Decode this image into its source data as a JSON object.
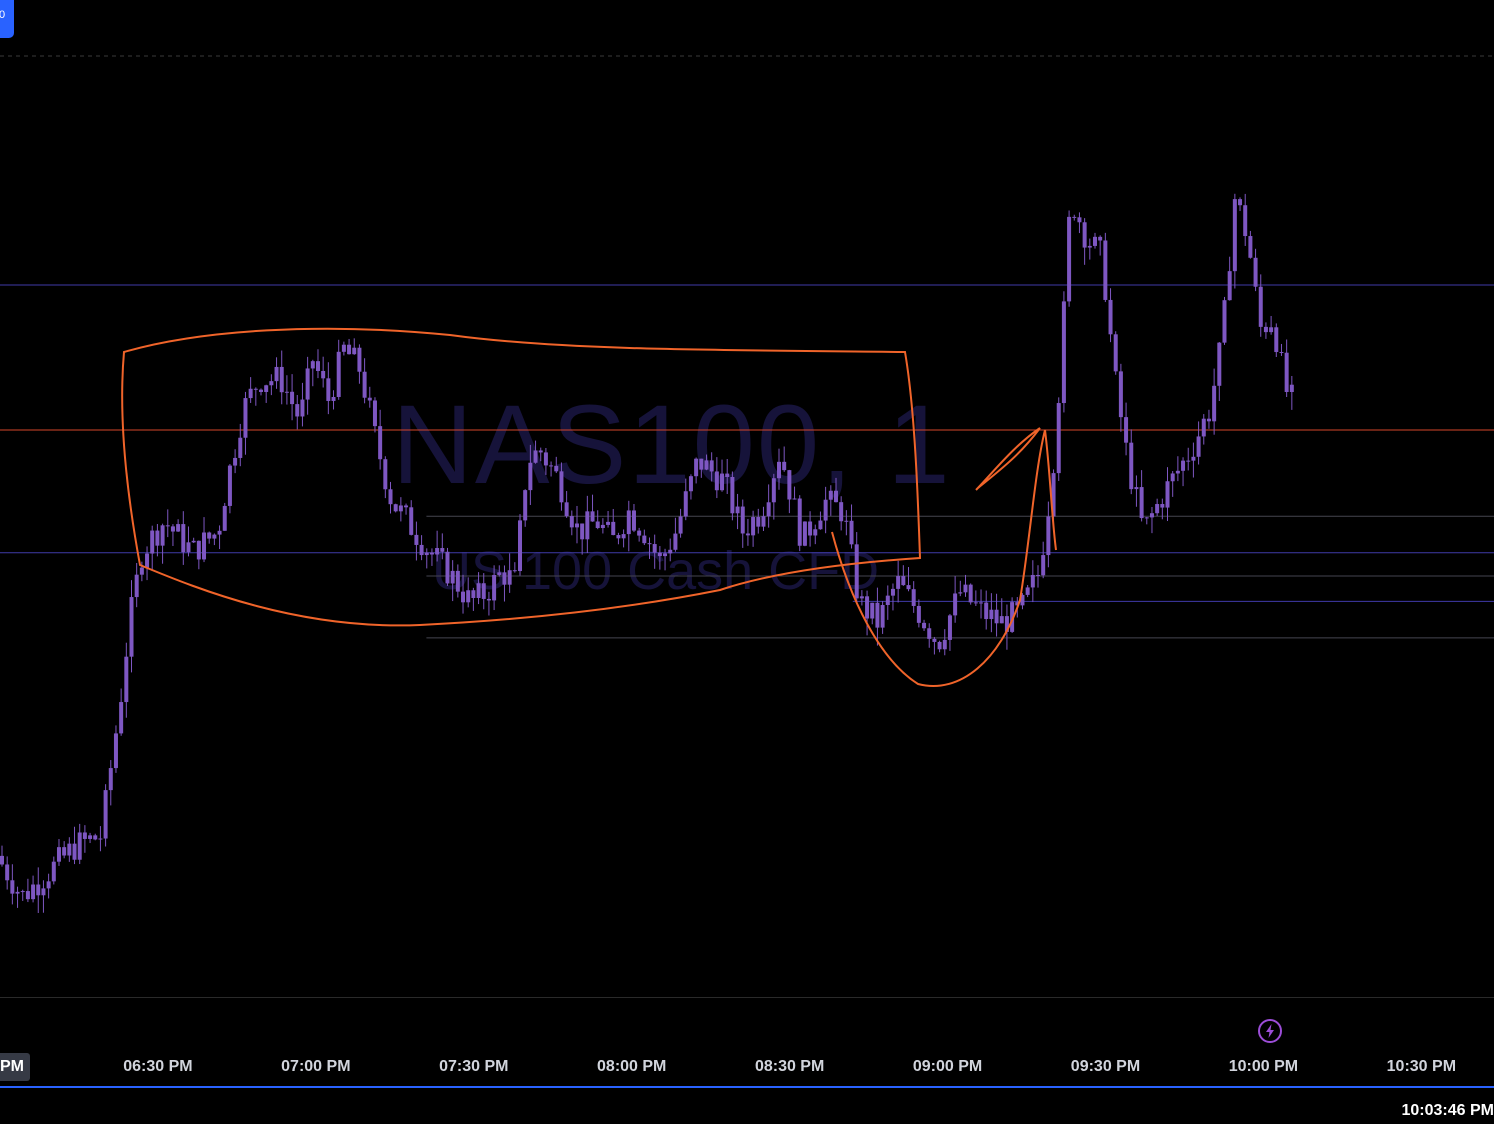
{
  "watermark": {
    "symbol": "NAS100, 1",
    "description": "US 100 Cash CFD"
  },
  "corner_button_label": "0",
  "time_axis": {
    "cut_label": "PM",
    "cut_label_2": "PM",
    "ticks": [
      {
        "label": "06:30 PM",
        "time": 18.5
      },
      {
        "label": "07:00 PM",
        "time": 19.0
      },
      {
        "label": "07:30 PM",
        "time": 19.5
      },
      {
        "label": "08:00 PM",
        "time": 20.0
      },
      {
        "label": "08:30 PM",
        "time": 20.5
      },
      {
        "label": "09:00 PM",
        "time": 21.0
      },
      {
        "label": "09:30 PM",
        "time": 21.5
      },
      {
        "label": "10:00 PM",
        "time": 22.0
      },
      {
        "label": "10:30 PM",
        "time": 22.5
      }
    ]
  },
  "clock": "10:03:46 PM",
  "colors": {
    "candle": "#7e57c2",
    "level_line": "#3f3aa8",
    "key_level": "#d4462a",
    "gray_level": "#45454f",
    "drawing": "#f0642a",
    "watermark": "#16133a"
  },
  "chart_data": {
    "type": "candlestick",
    "title": "",
    "xlabel": "",
    "ylabel": "",
    "x_unit": "hour",
    "x_range": [
      18.0,
      22.73
    ],
    "y_range": [
      0,
      1000
    ],
    "grid": false,
    "levels": [
      {
        "value": 713,
        "style": "line",
        "color": "#3f3aa8"
      },
      {
        "value": 570,
        "style": "line",
        "color": "#d4462a"
      },
      {
        "value": 449,
        "style": "line",
        "color": "#3f3aa8"
      },
      {
        "value": 401,
        "style": "line",
        "color": "#3f3aa8",
        "from": 20.7
      },
      {
        "value": 485,
        "style": "line",
        "color": "#45454f",
        "from": 19.35
      },
      {
        "value": 426,
        "style": "line",
        "color": "#45454f",
        "from": 19.35
      },
      {
        "value": 365,
        "style": "line",
        "color": "#45454f",
        "from": 19.35
      }
    ],
    "anchors": [
      [
        18.0,
        150
      ],
      [
        18.08,
        110
      ],
      [
        18.15,
        130
      ],
      [
        18.25,
        160
      ],
      [
        18.33,
        170
      ],
      [
        18.39,
        300
      ],
      [
        18.42,
        380
      ],
      [
        18.46,
        450
      ],
      [
        18.53,
        480
      ],
      [
        18.62,
        450
      ],
      [
        18.7,
        470
      ],
      [
        18.73,
        520
      ],
      [
        18.78,
        590
      ],
      [
        18.83,
        620
      ],
      [
        18.9,
        620
      ],
      [
        18.96,
        580
      ],
      [
        19.0,
        640
      ],
      [
        19.05,
        600
      ],
      [
        19.1,
        650
      ],
      [
        19.15,
        630
      ],
      [
        19.2,
        560
      ],
      [
        19.25,
        500
      ],
      [
        19.3,
        480
      ],
      [
        19.37,
        450
      ],
      [
        19.43,
        430
      ],
      [
        19.5,
        400
      ],
      [
        19.55,
        410
      ],
      [
        19.6,
        430
      ],
      [
        19.64,
        420
      ],
      [
        19.68,
        540
      ],
      [
        19.72,
        550
      ],
      [
        19.78,
        520
      ],
      [
        19.84,
        470
      ],
      [
        19.9,
        480
      ],
      [
        19.95,
        460
      ],
      [
        20.0,
        490
      ],
      [
        20.05,
        470
      ],
      [
        20.1,
        440
      ],
      [
        20.15,
        470
      ],
      [
        20.22,
        540
      ],
      [
        20.3,
        520
      ],
      [
        20.36,
        470
      ],
      [
        20.42,
        490
      ],
      [
        20.48,
        550
      ],
      [
        20.55,
        460
      ],
      [
        20.62,
        500
      ],
      [
        20.68,
        490
      ],
      [
        20.73,
        400
      ],
      [
        20.79,
        380
      ],
      [
        20.85,
        420
      ],
      [
        20.92,
        390
      ],
      [
        20.98,
        360
      ],
      [
        21.05,
        410
      ],
      [
        21.12,
        390
      ],
      [
        21.18,
        380
      ],
      [
        21.24,
        390
      ],
      [
        21.3,
        430
      ],
      [
        21.34,
        520
      ],
      [
        21.37,
        640
      ],
      [
        21.4,
        800
      ],
      [
        21.45,
        760
      ],
      [
        21.5,
        740
      ],
      [
        21.54,
        620
      ],
      [
        21.58,
        540
      ],
      [
        21.63,
        470
      ],
      [
        21.7,
        510
      ],
      [
        21.78,
        550
      ],
      [
        21.84,
        590
      ],
      [
        21.88,
        660
      ],
      [
        21.92,
        800
      ],
      [
        21.96,
        760
      ],
      [
        22.0,
        670
      ],
      [
        22.04,
        680
      ],
      [
        22.08,
        610
      ],
      [
        22.1,
        600
      ]
    ],
    "candle_count": 250
  }
}
